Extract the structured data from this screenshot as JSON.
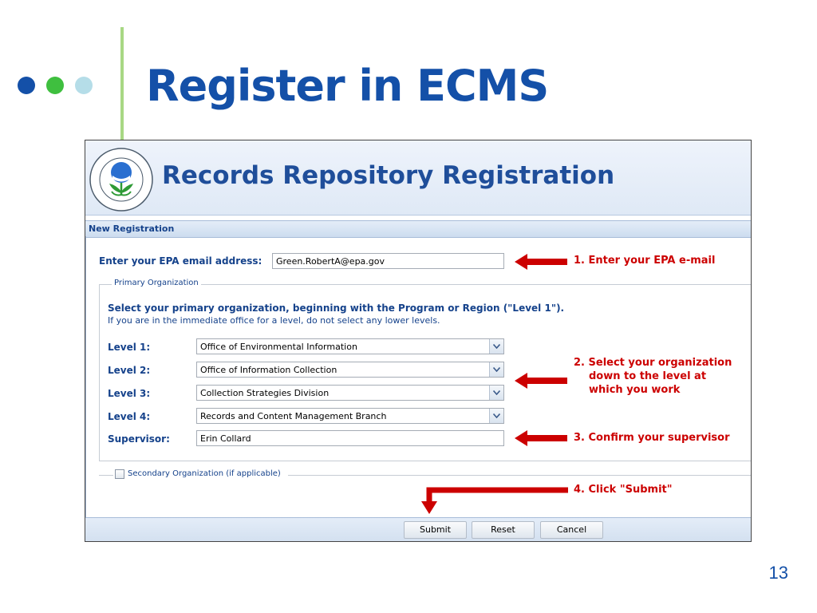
{
  "slide": {
    "title": "Register in ECMS",
    "page_number": "13",
    "colors": {
      "title": "#1450a8",
      "accent_line": "#a8d884",
      "dots": [
        "#1450a8",
        "#3fbf3f",
        "#b5dde8"
      ]
    }
  },
  "app": {
    "banner_title": "Records Repository Registration",
    "seal_icon": "epa-seal-icon",
    "section_title": "New Registration",
    "email": {
      "label": "Enter your EPA email address:",
      "value": "Green.RobertA@epa.gov"
    },
    "primary_org": {
      "legend": "Primary Organization",
      "instruction_bold": "Select your primary organization, beginning with the Program or Region (\"Level 1\").",
      "instruction": "If you are in the immediate office for a level, do not select any lower levels.",
      "levels": [
        {
          "label": "Level 1:",
          "value": "Office of Environmental Information"
        },
        {
          "label": "Level 2:",
          "value": "Office of Information Collection"
        },
        {
          "label": "Level 3:",
          "value": "Collection Strategies Division"
        },
        {
          "label": "Level 4:",
          "value": "Records and Content Management Branch"
        }
      ],
      "supervisor": {
        "label": "Supervisor:",
        "value": "Erin Collard"
      }
    },
    "secondary_org": {
      "label": "Secondary Organization (if applicable)",
      "checked": false
    },
    "buttons": {
      "submit": "Submit",
      "reset": "Reset",
      "cancel": "Cancel"
    }
  },
  "annotations": {
    "step1": "1. Enter your EPA e-mail",
    "step2_line1": "2. Select your organization",
    "step2_line2": "down to the level at",
    "step2_line3": "which you work",
    "step3": "3. Confirm your supervisor",
    "step4": "4. Click \"Submit\"",
    "color": "#cc0000"
  }
}
